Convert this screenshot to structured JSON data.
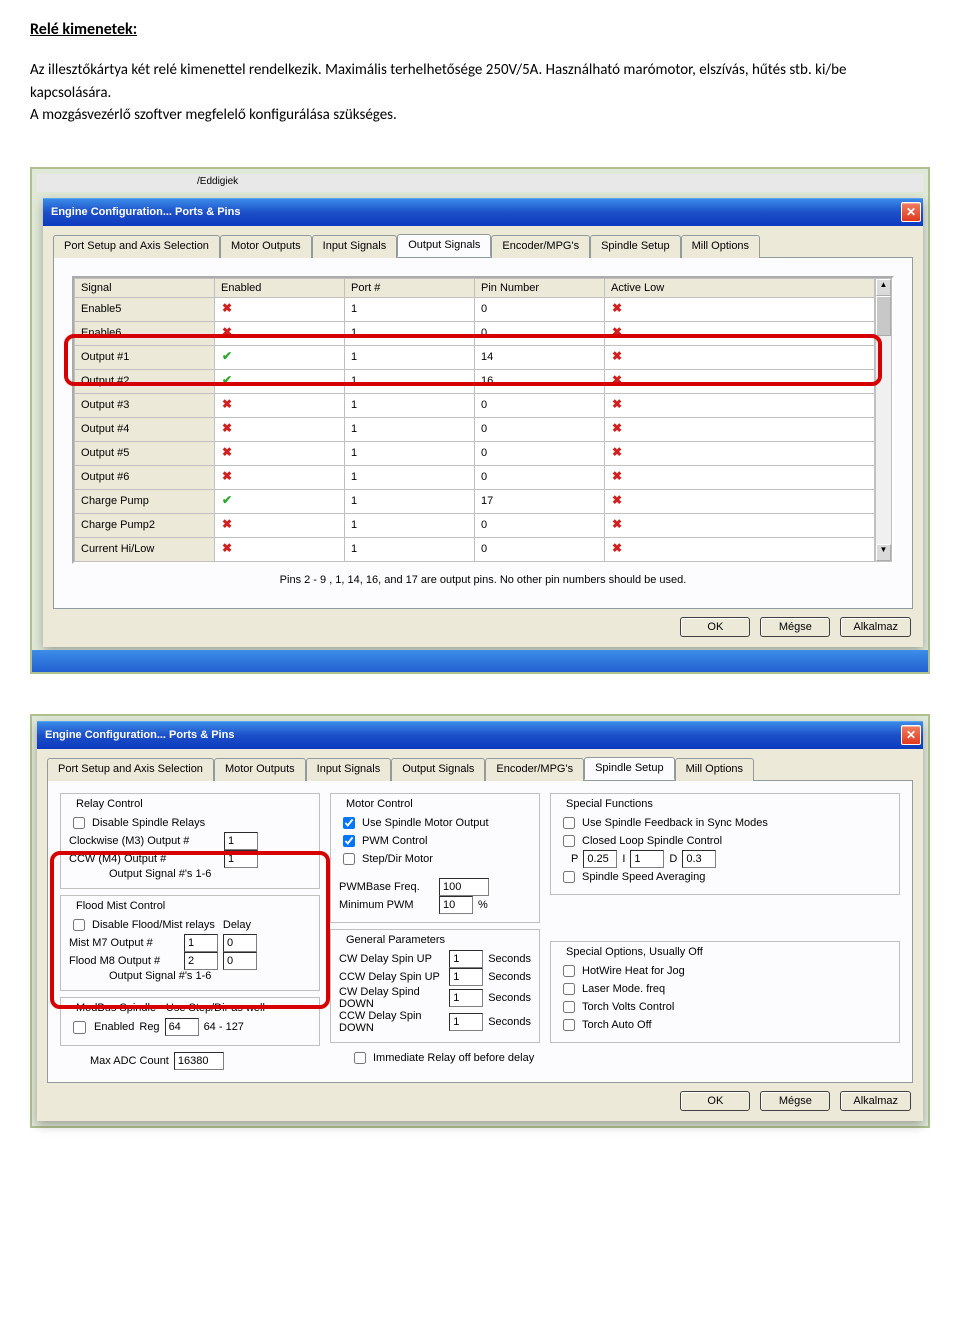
{
  "doc": {
    "heading": "Relé kimenetek:",
    "para": "Az illesztőkártya két relé kimenettel rendelkezik. Maximális terhelhetősége 250V/5A. Használható marómotor, elszívás, hűtés stb. ki/be kapcsolására.\nA mozgásvezérlő szoftver megfelelő konfigurálása szükséges."
  },
  "bg_hint": "/Eddigiek",
  "window_title": "Engine Configuration... Ports & Pins",
  "tabs": [
    "Port Setup and Axis Selection",
    "Motor Outputs",
    "Input Signals",
    "Output Signals",
    "Encoder/MPG's",
    "Spindle Setup",
    "Mill Options"
  ],
  "output_tab": {
    "cols": [
      "Signal",
      "Enabled",
      "Port #",
      "Pin Number",
      "Active Low"
    ],
    "rows": [
      {
        "sig": "Enable5",
        "en": false,
        "port": "1",
        "pin": "0",
        "low": false
      },
      {
        "sig": "Enable6",
        "en": false,
        "port": "1",
        "pin": "0",
        "low": false
      },
      {
        "sig": "Output #1",
        "en": true,
        "port": "1",
        "pin": "14",
        "low": false
      },
      {
        "sig": "Output #2",
        "en": true,
        "port": "1",
        "pin": "16",
        "low": false
      },
      {
        "sig": "Output #3",
        "en": false,
        "port": "1",
        "pin": "0",
        "low": false
      },
      {
        "sig": "Output #4",
        "en": false,
        "port": "1",
        "pin": "0",
        "low": false
      },
      {
        "sig": "Output #5",
        "en": false,
        "port": "1",
        "pin": "0",
        "low": false
      },
      {
        "sig": "Output #6",
        "en": false,
        "port": "1",
        "pin": "0",
        "low": false
      },
      {
        "sig": "Charge Pump",
        "en": true,
        "port": "1",
        "pin": "17",
        "low": false
      },
      {
        "sig": "Charge Pump2",
        "en": false,
        "port": "1",
        "pin": "0",
        "low": false
      },
      {
        "sig": "Current Hi/Low",
        "en": false,
        "port": "1",
        "pin": "0",
        "low": false
      }
    ],
    "note": "Pins 2 - 9 , 1, 14, 16, and 17 are output pins. No  other pin numbers should be used."
  },
  "spindle": {
    "relay": {
      "legend": "Relay Control",
      "disable": "Disable Spindle Relays",
      "cw_label": "Clockwise (M3)    Output #",
      "ccw_label": "CCW (M4)     Output #",
      "cw_val": "1",
      "ccw_val": "1",
      "note": "Output Signal #'s 1-6"
    },
    "flood": {
      "legend": "Flood Mist Control",
      "disable": "Disable Flood/Mist relays",
      "delay_lbl": "Delay",
      "mist_label": "Mist    M7 Output #",
      "flood_label": "Flood  M8 Output #",
      "mist_out": "1",
      "mist_delay": "0",
      "flood_out": "2",
      "flood_delay": "0",
      "note": "Output Signal #'s 1-6"
    },
    "modbus": {
      "legend": "ModBus Spindle - Use Step/Dir as well",
      "enabled": "Enabled",
      "reg_lbl": "Reg",
      "reg_val": "64",
      "range": "64 - 127",
      "max_lbl": "Max ADC Count",
      "max_val": "16380"
    },
    "motor": {
      "legend": "Motor Control",
      "use_out": "Use Spindle Motor Output",
      "pwm": "PWM Control",
      "stepdir": "Step/Dir Motor",
      "base_lbl": "PWMBase Freq.",
      "base_val": "100",
      "min_lbl": "Minimum PWM",
      "min_val": "10",
      "pct": "%"
    },
    "general": {
      "legend": "General Parameters",
      "cw_up": "CW Delay Spin UP",
      "cw_up_v": "1",
      "ccw_up": "CCW Delay Spin UP",
      "ccw_up_v": "1",
      "cw_dn": "CW Delay Spind DOWN",
      "cw_dn_v": "1",
      "ccw_dn": "CCW Delay Spin DOWN",
      "ccw_dn_v": "1",
      "sec": "Seconds",
      "immediate": "Immediate Relay off before delay"
    },
    "special_fn": {
      "legend": "Special Functions",
      "feedback": "Use Spindle Feedback in Sync Modes",
      "closed": "Closed Loop Spindle Control",
      "p_lbl": "P",
      "p_val": "0.25",
      "i_lbl": "I",
      "i_val": "1",
      "d_lbl": "D",
      "d_val": "0.3",
      "avg": "Spindle Speed Averaging"
    },
    "special_opt": {
      "legend": "Special Options, Usually Off",
      "hot": "HotWire Heat for Jog",
      "laser": "Laser Mode. freq",
      "torch_v": "Torch Volts Control",
      "torch_a": "Torch Auto Off"
    }
  },
  "buttons": {
    "ok": "OK",
    "cancel": "Mégse",
    "apply": "Alkalmaz"
  }
}
